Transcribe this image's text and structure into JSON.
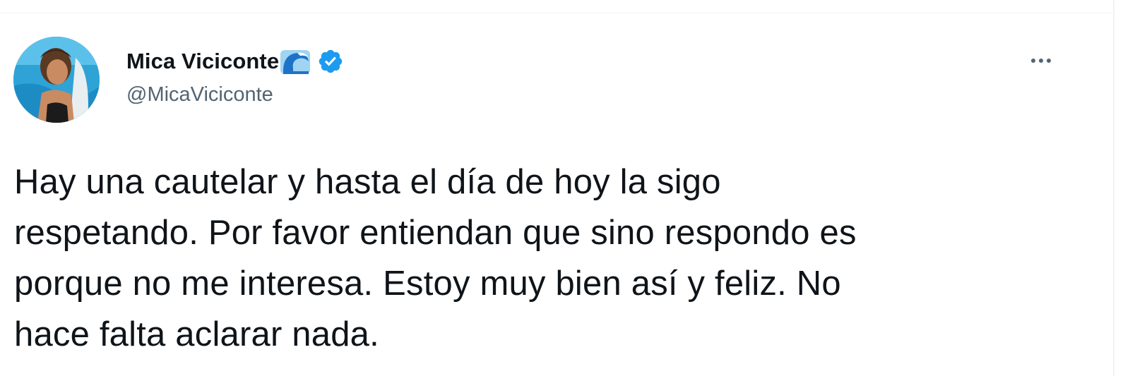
{
  "tweet": {
    "author": {
      "display_name": "Mica Viciconte",
      "handle": "@MicaViciconte",
      "name_emoji": "wave-icon",
      "verified": true,
      "verified_color": "#1d9bf0"
    },
    "menu_icon": "more-dots-icon",
    "text_lines": [
      "Hay una cautelar y hasta el día de hoy la sigo",
      "respetando. Por favor entiendan que sino respondo es",
      "porque no me interesa. Estoy muy bien así y feliz. No",
      "hace falta aclarar nada."
    ]
  },
  "colors": {
    "text_primary": "#0f1419",
    "text_secondary": "#536471",
    "divider": "#eff3f4"
  }
}
